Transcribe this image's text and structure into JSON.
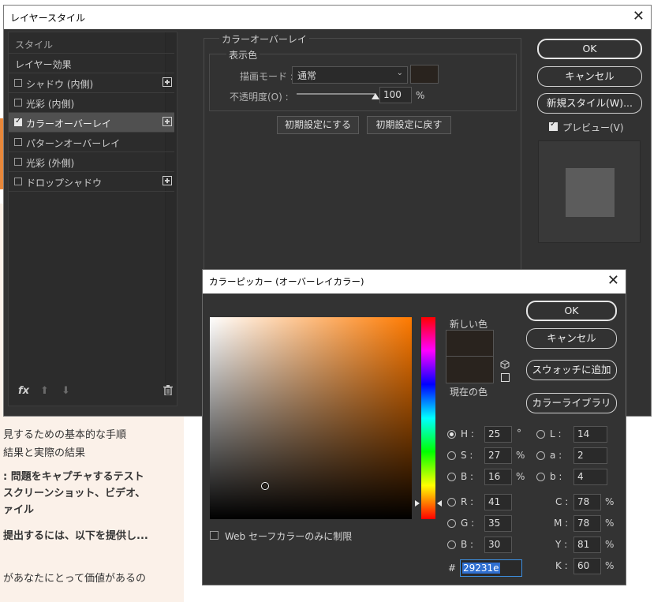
{
  "background_doc": {
    "lines": [
      {
        "text": "見するための基本的な手順",
        "bold": false
      },
      {
        "text": "結果と実際の結果",
        "bold": false
      },
      {
        "text": ": 問題をキャプチャするテスト",
        "bold": true
      },
      {
        "text": "スクリーンショット、ビデオ、",
        "bold": true
      },
      {
        "text": "ァイル",
        "bold": true
      },
      {
        "text": "提出するには、以下を提供し...",
        "bold": true
      },
      {
        "text": "があなたにとって価値があるの",
        "bold": false
      }
    ]
  },
  "layer_style": {
    "title": "レイヤースタイル",
    "close": "✕",
    "list": [
      {
        "label": "スタイル",
        "type": "header"
      },
      {
        "label": "レイヤー効果",
        "type": "header"
      },
      {
        "label": "シャドウ (内側)",
        "checked": false,
        "plus": true
      },
      {
        "label": "光彩 (内側)",
        "checked": false,
        "plus": false
      },
      {
        "label": "カラーオーバーレイ",
        "checked": true,
        "plus": true,
        "selected": true
      },
      {
        "label": "パターンオーバーレイ",
        "checked": false,
        "plus": false
      },
      {
        "label": "光彩 (外側)",
        "checked": false,
        "plus": false
      },
      {
        "label": "ドロップシャドウ",
        "checked": false,
        "plus": true
      }
    ],
    "bottom": {
      "fx": "fx",
      "up": "⬆",
      "down": "⬇",
      "trash": "🗑"
    },
    "overlay_title": "カラーオーバーレイ",
    "color_group_title": "表示色",
    "blend_mode_label": "描画モード :",
    "blend_mode_value": "通常",
    "overlay_color": "#29231e",
    "opacity_label": "不透明度(O) :",
    "opacity_value": "100",
    "opacity_unit": "%",
    "opacity_fraction": 1.0,
    "btn_make_default": "初期設定にする",
    "btn_reset_default": "初期設定に戻す",
    "ok": "OK",
    "cancel": "キャンセル",
    "new_style": "新規スタイル(W)...",
    "preview_label": "プレビュー(V)"
  },
  "picker": {
    "title": "カラーピッカー (オーバーレイカラー)",
    "close": "✕",
    "ok": "OK",
    "cancel": "キャンセル",
    "add_swatch": "スウォッチに追加",
    "library": "カラーライブラリ",
    "new_label": "新しい色",
    "current_label": "現在の色",
    "new_color": "#29231e",
    "current_color": "#29231e",
    "web_only": "Web セーフカラーのみに制限",
    "hsb": [
      {
        "label": "H :",
        "value": "25",
        "unit": "°",
        "selected": true
      },
      {
        "label": "S :",
        "value": "27",
        "unit": "%",
        "selected": false
      },
      {
        "label": "B :",
        "value": "16",
        "unit": "%",
        "selected": false
      }
    ],
    "lab": [
      {
        "label": "L :",
        "value": "14"
      },
      {
        "label": "a :",
        "value": "2"
      },
      {
        "label": "b :",
        "value": "4"
      }
    ],
    "rgb": [
      {
        "label": "R :",
        "value": "41"
      },
      {
        "label": "G :",
        "value": "35"
      },
      {
        "label": "B :",
        "value": "30"
      }
    ],
    "cmyk": [
      {
        "label": "C :",
        "value": "78",
        "unit": "%"
      },
      {
        "label": "M :",
        "value": "78",
        "unit": "%"
      },
      {
        "label": "Y :",
        "value": "81",
        "unit": "%"
      },
      {
        "label": "K :",
        "value": "60",
        "unit": "%"
      }
    ],
    "hex_label": "#",
    "hex_value": "29231e"
  }
}
